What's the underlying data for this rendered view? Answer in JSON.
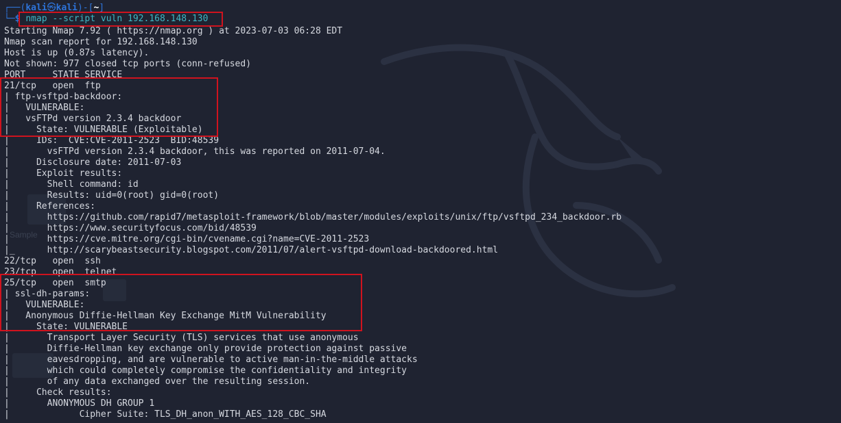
{
  "prompt": {
    "corner_top": "┌──(",
    "user": "kali",
    "at_symbol": "㉿",
    "host": "kali",
    "path_open": ")-[",
    "path": "~",
    "path_close": "]",
    "corner_bottom": "└─",
    "dollar": "$",
    "command": "nmap --script vuln 192.168.148.130"
  },
  "output_lines": [
    "Starting Nmap 7.92 ( https://nmap.org ) at 2023-07-03 06:28 EDT",
    "Nmap scan report for 192.168.148.130",
    "Host is up (0.87s latency).",
    "Not shown: 977 closed tcp ports (conn-refused)",
    "PORT     STATE SERVICE",
    "21/tcp   open  ftp",
    "| ftp-vsftpd-backdoor:",
    "|   VULNERABLE:",
    "|   vsFTPd version 2.3.4 backdoor",
    "|     State: VULNERABLE (Exploitable)",
    "|     IDs:  CVE:CVE-2011-2523  BID:48539",
    "|       vsFTPd version 2.3.4 backdoor, this was reported on 2011-07-04.",
    "|     Disclosure date: 2011-07-03",
    "|     Exploit results:",
    "|       Shell command: id",
    "|       Results: uid=0(root) gid=0(root)",
    "|     References:",
    "|       https://github.com/rapid7/metasploit-framework/blob/master/modules/exploits/unix/ftp/vsftpd_234_backdoor.rb",
    "|       https://www.securityfocus.com/bid/48539",
    "|       https://cve.mitre.org/cgi-bin/cvename.cgi?name=CVE-2011-2523",
    "|_      http://scarybeastsecurity.blogspot.com/2011/07/alert-vsftpd-download-backdoored.html",
    "22/tcp   open  ssh",
    "23/tcp   open  telnet",
    "25/tcp   open  smtp",
    "| ssl-dh-params:",
    "|   VULNERABLE:",
    "|   Anonymous Diffie-Hellman Key Exchange MitM Vulnerability",
    "|     State: VULNERABLE",
    "|       Transport Layer Security (TLS) services that use anonymous",
    "|       Diffie-Hellman key exchange only provide protection against passive",
    "|       eavesdropping, and are vulnerable to active man-in-the-middle attacks",
    "|       which could completely compromise the confidentiality and integrity",
    "|       of any data exchanged over the resulting session.",
    "|     Check results:",
    "|       ANONYMOUS DH GROUP 1",
    "|             Cipher Suite: TLS_DH_anon_WITH_AES_128_CBC_SHA"
  ],
  "colors": {
    "background": "#1f2331",
    "text": "#d6d9e0",
    "prompt_blue": "#2e74d9",
    "command_cyan": "#3fb7c4",
    "highlight_red": "#d0131e"
  },
  "highlights": [
    "command-highlight",
    "ftp-vuln-highlight",
    "smtp-vuln-highlight"
  ]
}
